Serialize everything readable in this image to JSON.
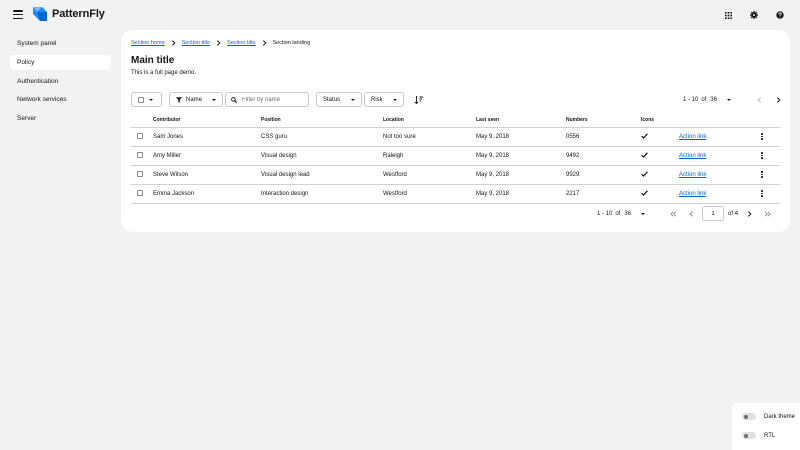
{
  "header": {
    "brand": "PatternFly",
    "tools": [
      "apps-grid-icon",
      "gear-icon",
      "help-icon"
    ]
  },
  "sidebar": {
    "items": [
      {
        "label": "System panel",
        "current": false
      },
      {
        "label": "Policy",
        "current": true
      },
      {
        "label": "Authentication",
        "current": false
      },
      {
        "label": "Network services",
        "current": false
      },
      {
        "label": "Server",
        "current": false
      }
    ]
  },
  "breadcrumb": {
    "items": [
      "Section home",
      "Section title",
      "Section title"
    ],
    "current": "Section landing"
  },
  "main": {
    "title": "Main title",
    "description": "This is a full page demo."
  },
  "toolbar": {
    "filter_attribute": "Name",
    "search_placeholder": "Filter by name",
    "status_label": "Status",
    "risk_label": "Risk"
  },
  "pagination": {
    "range": "1 - 10",
    "of_word": "of",
    "total": "36",
    "current_page": "1",
    "page_count_label": "of 4"
  },
  "table": {
    "headers": [
      "Contributor",
      "Position",
      "Location",
      "Last seen",
      "Numbers",
      "Icons"
    ],
    "rows": [
      {
        "contributor": "Sam Jones",
        "position": "CSS guru",
        "location": "Not too sure",
        "last_seen": "May 9, 2018",
        "numbers": "0556",
        "action": "Action link"
      },
      {
        "contributor": "Amy Miller",
        "position": "Visual design",
        "location": "Raleigh",
        "last_seen": "May 9, 2018",
        "numbers": "9492",
        "action": "Action link"
      },
      {
        "contributor": "Steve Wilson",
        "position": "Visual design lead",
        "location": "Westford",
        "last_seen": "May 9, 2018",
        "numbers": "9929",
        "action": "Action link"
      },
      {
        "contributor": "Emma Jackson",
        "position": "Interaction design",
        "location": "Westford",
        "last_seen": "May 9, 2018",
        "numbers": "2217",
        "action": "Action link"
      }
    ]
  },
  "theme": {
    "dark_label": "Dark theme",
    "rtl_label": "RTL"
  },
  "colors": {
    "link": "#0066cc",
    "background": "#f2f2f2",
    "card": "#ffffff"
  }
}
